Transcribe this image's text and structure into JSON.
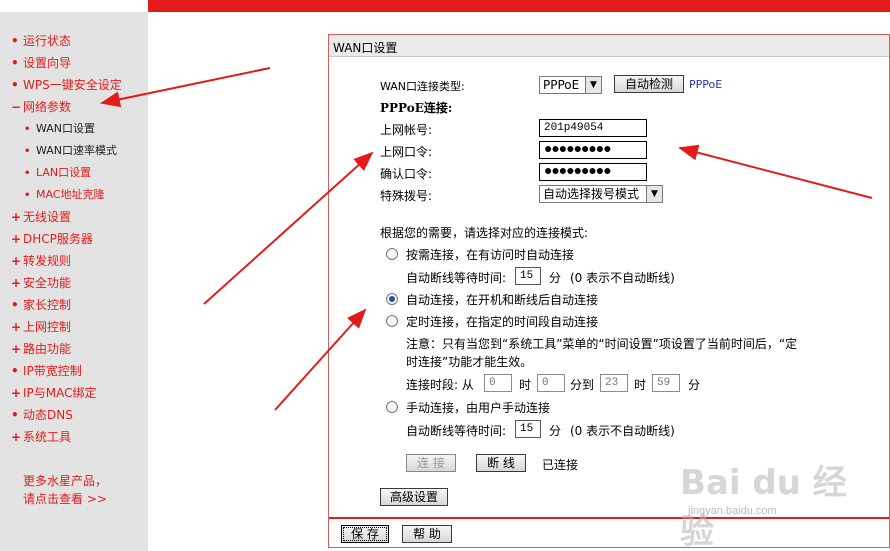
{
  "sidebar": {
    "items": [
      {
        "label": "运行状态"
      },
      {
        "label": "设置向导"
      },
      {
        "label": "WPS一键安全设定"
      },
      {
        "label": "网络参数"
      },
      {
        "label": "WAN口设置"
      },
      {
        "label": "WAN口速率模式"
      },
      {
        "label": "LAN口设置"
      },
      {
        "label": "MAC地址克隆"
      },
      {
        "label": "无线设置"
      },
      {
        "label": "DHCP服务器"
      },
      {
        "label": "转发规则"
      },
      {
        "label": "安全功能"
      },
      {
        "label": "家长控制"
      },
      {
        "label": "上网控制"
      },
      {
        "label": "路由功能"
      },
      {
        "label": "IP带宽控制"
      },
      {
        "label": "IP与MAC绑定"
      },
      {
        "label": "动态DNS"
      },
      {
        "label": "系统工具"
      }
    ],
    "promo_line1": "更多水星产品，",
    "promo_line2": "请点击查看 >>"
  },
  "panel": {
    "title": "WAN口设置",
    "conn_type_label": "WAN口连接类型:",
    "conn_type_value": "PPPoE",
    "detect_button": "自动检测",
    "detect_result": "PPPoE",
    "pppoe_heading": "PPPoE连接:",
    "account_label": "上网帐号:",
    "account_value": "201p49054",
    "password_label": "上网口令:",
    "password_value": "●●●●●●●●●",
    "confirm_label": "确认口令:",
    "confirm_value": "●●●●●●●●●",
    "special_dial_label": "特殊拨号:",
    "special_dial_value": "自动选择拨号模式",
    "mode_prompt": "根据您的需要，请选择对应的连接模式:",
    "mode_on_demand": "按需连接，在有访问时自动连接",
    "idle_wait_label": "自动断线等待时间:",
    "idle_wait_value": "15",
    "idle_unit": "分",
    "idle_hint": "(0 表示不自动断线)",
    "mode_auto": "自动连接，在开机和断线后自动连接",
    "mode_timed": "定时连接，在指定的时间段自动连接",
    "note_line1": "注意：只有当您到“系统工具”菜单的“时间设置”项设置了当前时间后，“定",
    "note_line2": "时连接”功能才能生效。",
    "period_label": "连接时段: 从",
    "from_hour": "0",
    "hour_unit": "时",
    "from_min": "0",
    "to_label": "分到",
    "to_hour": "23",
    "to_min": "59",
    "min_unit": "分",
    "mode_manual": "手动连接，由用户手动连接",
    "manual_wait_value": "15",
    "connect_button": "连 接",
    "disconnect_button": "断 线",
    "status": "已连接",
    "advanced_button": "高级设置",
    "save_button": "保 存",
    "help_button": "帮 助"
  },
  "watermark": {
    "brand": "Bai du 经验",
    "url": "jingyan.baidu.com"
  },
  "colors": {
    "accent_red": "#e41b1b",
    "sidebar_bg": "#e3e3e3",
    "link_blue": "#1a3aa8"
  }
}
